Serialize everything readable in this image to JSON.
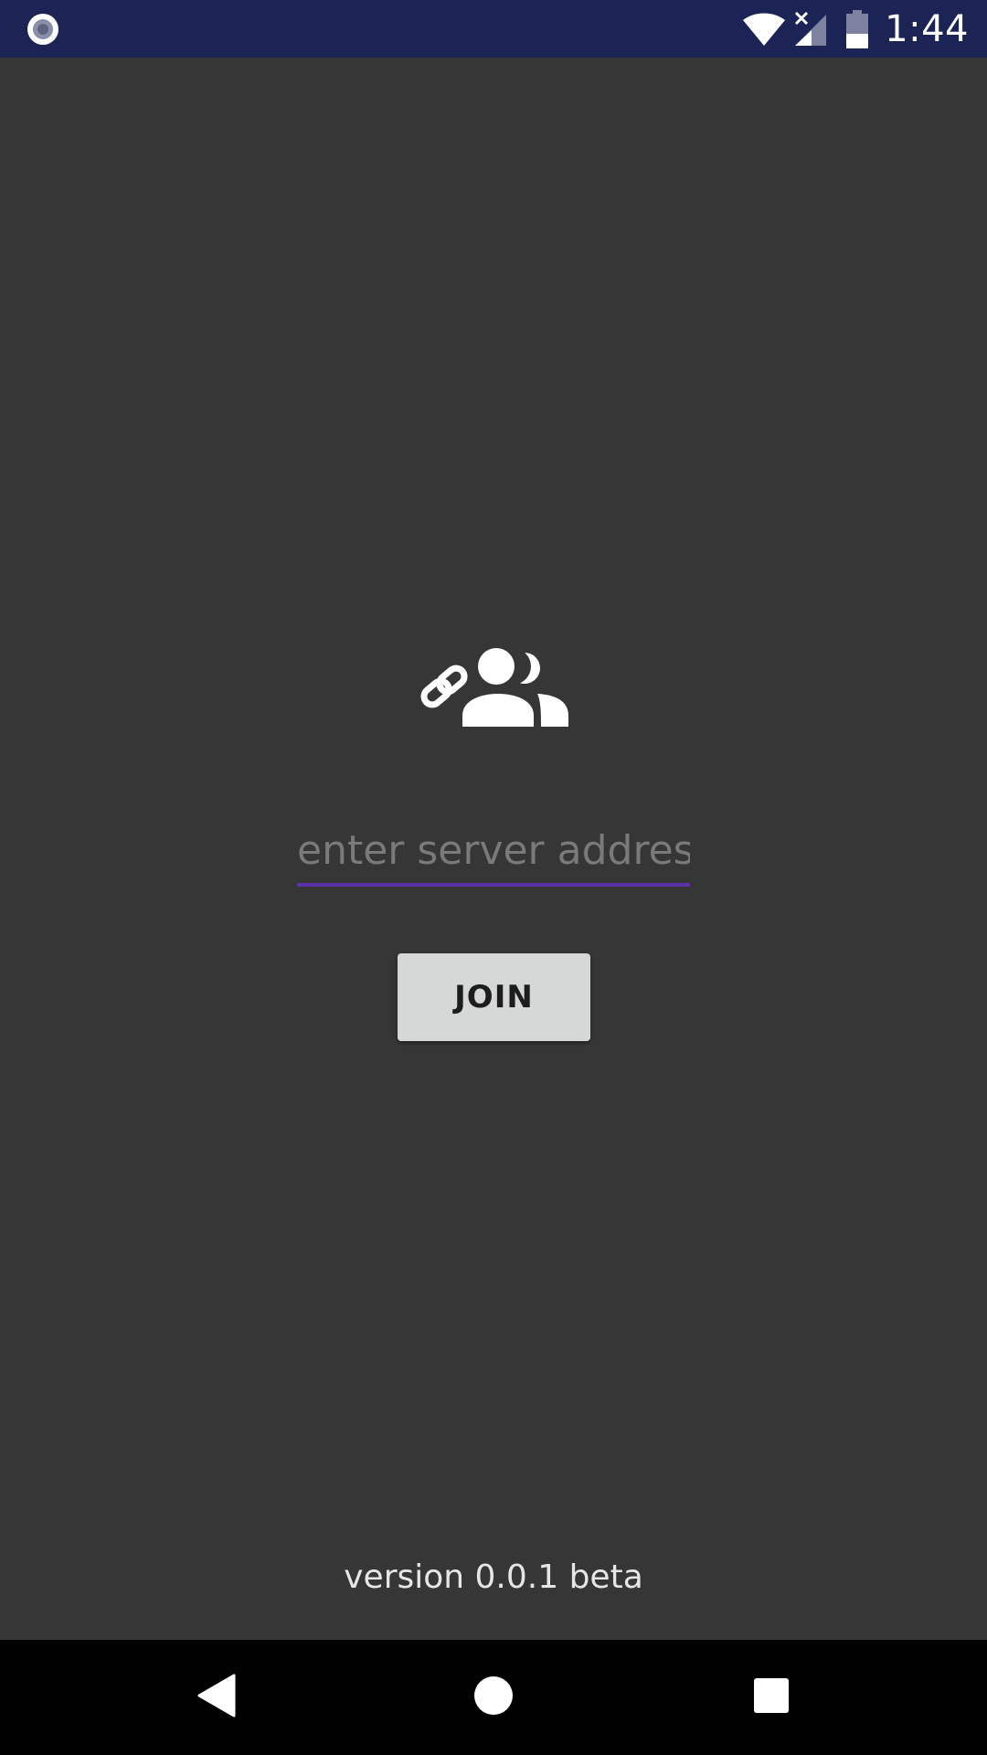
{
  "status_bar": {
    "time": "1:44",
    "icons": [
      "record-icon",
      "wifi-icon",
      "signal-no-data-icon",
      "battery-icon"
    ]
  },
  "main": {
    "logo_icon": "link-people-icon",
    "server_input": {
      "placeholder": "enter server address",
      "value": ""
    },
    "join_label": "JOIN",
    "version": "version 0.0.1 beta"
  },
  "nav_bar": {
    "icons": [
      "back-icon",
      "home-icon",
      "recents-icon"
    ]
  },
  "colors": {
    "background": "#363636",
    "status_bar": "#1b2455",
    "accent_underline": "#5a31a8",
    "button": "#d6d7d7",
    "nav_bar": "#000000"
  }
}
